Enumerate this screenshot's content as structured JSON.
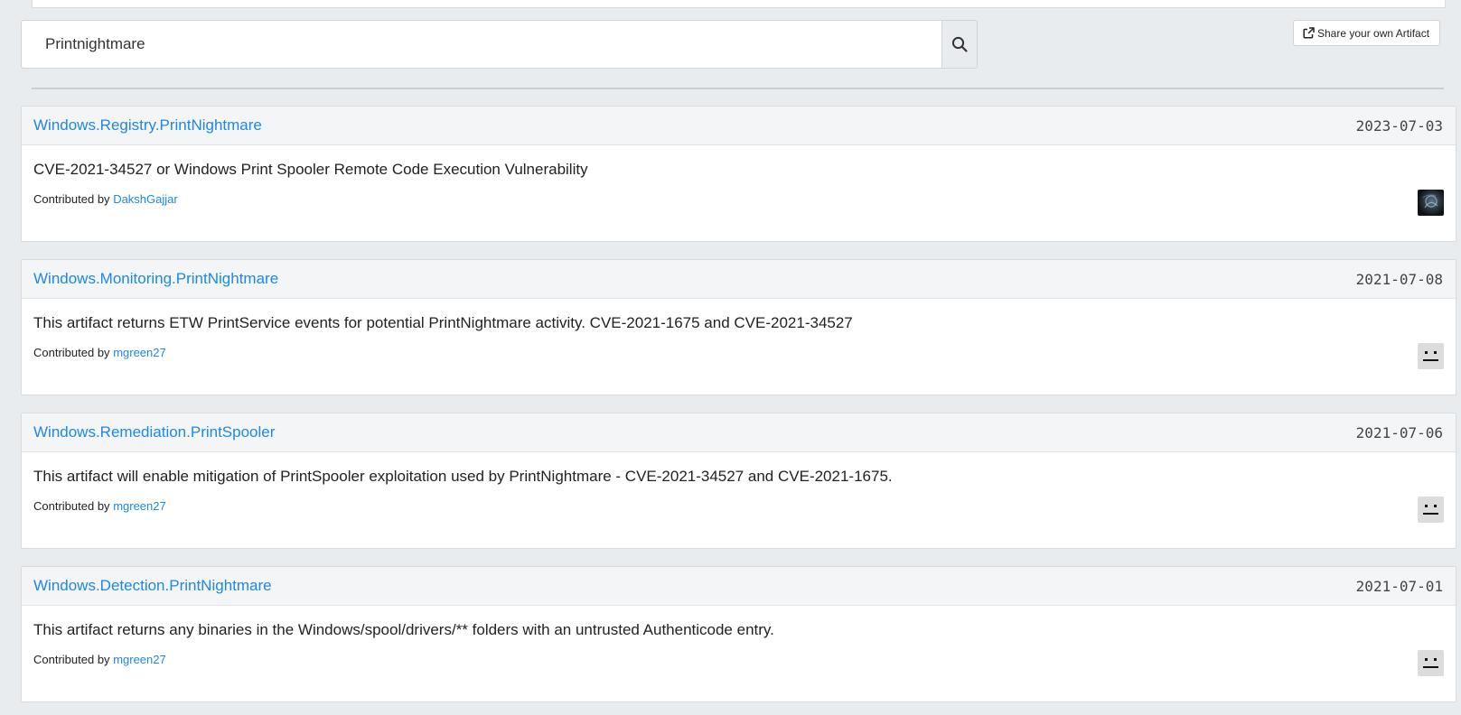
{
  "search": {
    "value": "Printnightmare"
  },
  "share_button": {
    "label": "Share your own Artifact"
  },
  "contributed_prefix": "Contributed by",
  "artifacts": [
    {
      "name": "Windows.Registry.PrintNightmare",
      "date": "2023-07-03",
      "description": "CVE-2021-34527 or Windows Print Spooler Remote Code Execution Vulnerability",
      "contributor": "DakshGajjar",
      "avatar": "photo-avatar"
    },
    {
      "name": "Windows.Monitoring.PrintNightmare",
      "date": "2021-07-08",
      "description": "This artifact returns ETW PrintService events for potential PrintNightmare activity. CVE-2021-1675 and CVE-2021-34527",
      "contributor": "mgreen27",
      "avatar": "neutral-face-avatar"
    },
    {
      "name": "Windows.Remediation.PrintSpooler",
      "date": "2021-07-06",
      "description": "This artifact will enable mitigation of PrintSpooler exploitation used by PrintNightmare - CVE-2021-34527 and CVE-2021-1675.",
      "contributor": "mgreen27",
      "avatar": "neutral-face-avatar"
    },
    {
      "name": "Windows.Detection.PrintNightmare",
      "date": "2021-07-01",
      "description": "This artifact returns any binaries in the Windows/spool/drivers/** folders with an untrusted Authenticode entry.",
      "contributor": "mgreen27",
      "avatar": "neutral-face-avatar"
    }
  ],
  "colors": {
    "link": "#1e88e5",
    "page_background": "#e9ecef",
    "card_header": "#f4f5f6"
  }
}
